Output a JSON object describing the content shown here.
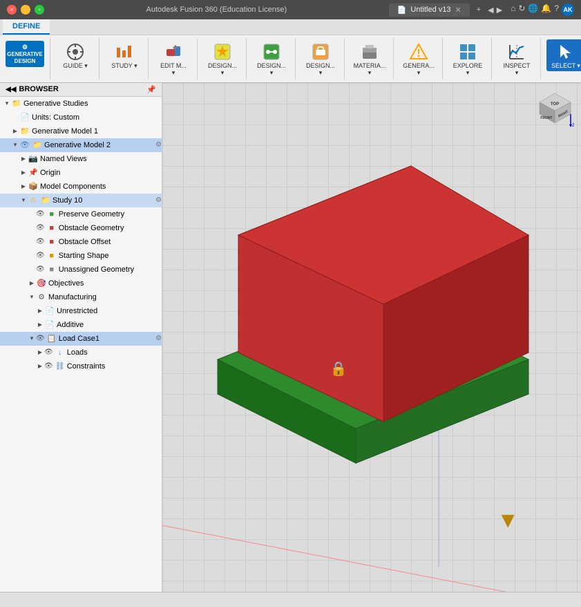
{
  "titlebar": {
    "title": "Autodesk Fusion 360 (Education License)",
    "tab_label": "Untitled v13",
    "close_label": "×",
    "add_tab_label": "+",
    "icons": {
      "close": "✕",
      "minimize": "−",
      "maximize": "+"
    }
  },
  "ribbon": {
    "active_tab": "DEFINE",
    "tabs": [
      "DEFINE"
    ],
    "tools": [
      {
        "id": "generative-design",
        "label": "GENERATIVE\nDESIGN",
        "icon": "⚙",
        "active": false
      },
      {
        "id": "guide",
        "label": "GUIDE",
        "icon": "◎",
        "dropdown": true
      },
      {
        "id": "study",
        "label": "STUDY",
        "icon": "📊",
        "dropdown": true
      },
      {
        "id": "edit-model",
        "label": "EDIT M...",
        "icon": "✏",
        "dropdown": true
      },
      {
        "id": "design-criteria",
        "label": "DESIGN...",
        "icon": "🎨",
        "dropdown": true
      },
      {
        "id": "design-connect",
        "label": "DESIGN...",
        "icon": "🔗",
        "dropdown": true
      },
      {
        "id": "design-constraints",
        "label": "DESIGN...",
        "icon": "📐",
        "dropdown": true
      },
      {
        "id": "materials",
        "label": "MATERIA...",
        "icon": "🧱",
        "dropdown": true
      },
      {
        "id": "generate",
        "label": "GENERA...",
        "icon": "⚡",
        "dropdown": true
      },
      {
        "id": "explore",
        "label": "EXPLORE",
        "icon": "🔍",
        "dropdown": true
      },
      {
        "id": "inspect",
        "label": "INSPECT",
        "icon": "📏",
        "dropdown": true
      },
      {
        "id": "select",
        "label": "SELECT",
        "icon": "↖",
        "active": true
      }
    ]
  },
  "browser": {
    "header": "BROWSER",
    "items": [
      {
        "id": "generative-studies",
        "label": "Generative Studies",
        "indent": 0,
        "arrow": "open",
        "icon": "📁",
        "icons_right": []
      },
      {
        "id": "units-custom",
        "label": "Units: Custom",
        "indent": 1,
        "arrow": "empty",
        "icon": "📄",
        "icons_right": []
      },
      {
        "id": "generative-model-1",
        "label": "Generative Model 1",
        "indent": 1,
        "arrow": "closed",
        "icon": "📁",
        "icons_right": []
      },
      {
        "id": "generative-model-2",
        "label": "Generative Model 2",
        "indent": 1,
        "arrow": "open",
        "icon": "📁",
        "icons_right": [
          "👁",
          "⚙"
        ],
        "selected": true
      },
      {
        "id": "named-views",
        "label": "Named Views",
        "indent": 2,
        "arrow": "closed",
        "icon": "📷",
        "icons_right": []
      },
      {
        "id": "origin",
        "label": "Origin",
        "indent": 2,
        "arrow": "closed",
        "icon": "📌",
        "icons_right": []
      },
      {
        "id": "model-components",
        "label": "Model Components",
        "indent": 2,
        "arrow": "closed",
        "icon": "📦",
        "icons_right": []
      },
      {
        "id": "study-10",
        "label": "Study 10",
        "indent": 2,
        "arrow": "open",
        "icon": "⚠",
        "icons_right": [
          "⚙"
        ],
        "warning": true
      },
      {
        "id": "preserve-geometry",
        "label": "Preserve Geometry",
        "indent": 3,
        "arrow": "empty",
        "icon": "🟢",
        "icons_right": [
          "👁"
        ]
      },
      {
        "id": "obstacle-geometry",
        "label": "Obstacle Geometry",
        "indent": 3,
        "arrow": "empty",
        "icon": "🔴",
        "icons_right": [
          "👁"
        ]
      },
      {
        "id": "obstacle-offset",
        "label": "Obstacle Offset",
        "indent": 3,
        "arrow": "empty",
        "icon": "🔴",
        "icons_right": [
          "👁"
        ]
      },
      {
        "id": "starting-shape",
        "label": "Starting Shape",
        "indent": 3,
        "arrow": "empty",
        "icon": "🟡",
        "icons_right": [
          "👁"
        ]
      },
      {
        "id": "unassigned-geometry",
        "label": "Unassigned Geometry",
        "indent": 3,
        "arrow": "empty",
        "icon": "⬜",
        "icons_right": [
          "👁"
        ]
      },
      {
        "id": "objectives",
        "label": "Objectives",
        "indent": 3,
        "arrow": "closed",
        "icon": "🎯",
        "icons_right": []
      },
      {
        "id": "manufacturing",
        "label": "Manufacturing",
        "indent": 3,
        "arrow": "open",
        "icon": "⚙",
        "icons_right": []
      },
      {
        "id": "unrestricted",
        "label": "Unrestricted",
        "indent": 4,
        "arrow": "closed",
        "icon": "📄",
        "icons_right": []
      },
      {
        "id": "additive",
        "label": "Additive",
        "indent": 4,
        "arrow": "closed",
        "icon": "📄",
        "icons_right": []
      },
      {
        "id": "load-case1",
        "label": "Load Case1",
        "indent": 3,
        "arrow": "open",
        "icon": "📋",
        "icons_right": [
          "👁",
          "⚙"
        ],
        "highlighted": true
      },
      {
        "id": "loads",
        "label": "Loads",
        "indent": 4,
        "arrow": "closed",
        "icon": "↓",
        "icons_right": [
          "👁"
        ]
      },
      {
        "id": "constraints",
        "label": "Constraints",
        "indent": 4,
        "arrow": "closed",
        "icon": "⛓",
        "icons_right": [
          "👁"
        ]
      }
    ]
  },
  "model": {
    "lock_icon": "🔒",
    "down_arrow": "↓"
  },
  "statusbar": {
    "text": ""
  },
  "orientation_cube": {
    "top": "TOP",
    "front": "FRONT",
    "right": "RIGHT"
  }
}
